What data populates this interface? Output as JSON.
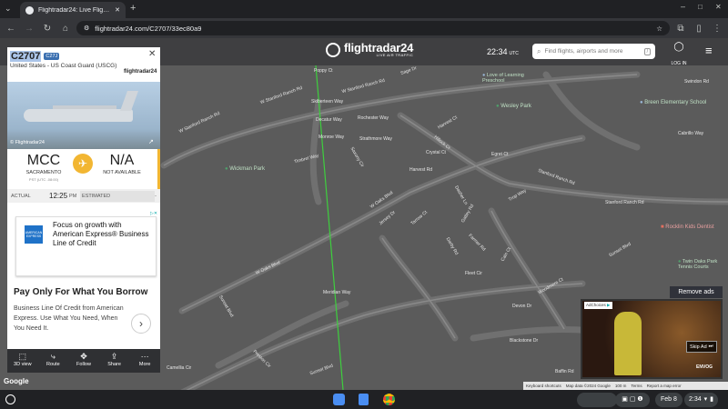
{
  "browser": {
    "tab_title": "Flightradar24: Live Flight Tracker",
    "url": "flightradar24.com/C2707/33ec80a9"
  },
  "header": {
    "logo": "flightradar24",
    "logo_sub": "LIVE AIR TRAFFIC",
    "time": "22:34",
    "time_zone": "UTC",
    "search_placeholder": "Find flights, airports and more",
    "search_key": "/",
    "login": "LOG IN"
  },
  "panel": {
    "callsign": "C2707",
    "type_badge": "C27J",
    "operator": "United States - US Coast Guard (USCG)",
    "operator_logo": "flightradar24",
    "photo_credit": "© Flightradar24",
    "origin": {
      "code": "MCC",
      "city": "SACRAMENTO",
      "tz": "PST (UTC -08:00)"
    },
    "destination": {
      "code": "N/A",
      "city": "NOT AVAILABLE"
    },
    "actual_label": "ACTUAL",
    "actual_time": "12:25",
    "actual_ampm": "PM",
    "estimated_label": "ESTIMATED",
    "estimated_value": "-",
    "ad": {
      "brand": "AMERICAN EXPRESS",
      "title": "Focus on growth with American Express® Business Line of Credit",
      "headline": "Pay Only For What You Borrow",
      "body": "Business Line Of Credit from American Express. Use What You Need, When You Need It.",
      "more": "Learn More"
    },
    "tabs": [
      {
        "label": "3D view",
        "icon": "cube-icon"
      },
      {
        "label": "Route",
        "icon": "route-icon"
      },
      {
        "label": "Follow",
        "icon": "follow-icon"
      },
      {
        "label": "Share",
        "icon": "share-icon"
      },
      {
        "label": "More",
        "icon": "more-icon"
      }
    ]
  },
  "map": {
    "streets": [
      "Poppy Ct",
      "Sage Dr",
      "W Stanford Ranch Rd",
      "W Stanford Ranch Rd",
      "Skiberteen Way",
      "Decatur Way",
      "Rochester Way",
      "Harvest Ct",
      "Monroe Way",
      "Strathmore Way",
      "Hillock Ct",
      "W Stanford Ranch Rd",
      "Timbrel Way",
      "Saxony Cir",
      "Crystal Ct",
      "Harvest Rd",
      "Egret Ct",
      "Stanford Ranch Rd",
      "Trop Way",
      "Stanford Ranch Rd",
      "W Oaks Blvd",
      "Jersey Dr",
      "Tarrow Ct",
      "Dasher Ln",
      "Gatley Rd",
      "Farmer Rd",
      "Darby Rd",
      "Cain Ct",
      "W Oaks Blvd",
      "Meridian Way",
      "Fleet Cir",
      "Woodmere Ct",
      "Devon Dr",
      "Sunset Blvd",
      "Preston Cir",
      "Blackstone Dr",
      "Camellia Cir",
      "Sunset Blvd",
      "Baffin Rd",
      "Swindon Rd",
      "Cabrillo Way",
      "Sunset Blvd"
    ],
    "pois": [
      {
        "name": "Love of Learning Preschool"
      },
      {
        "name": "Wesley Park"
      },
      {
        "name": "Breen Elementary School"
      },
      {
        "name": "Wickman Park"
      },
      {
        "name": "Rocklin Kids Dentist"
      },
      {
        "name": "Twin Oaks Park Tennis Courts"
      }
    ],
    "attribution": [
      "Keyboard shortcuts",
      "Map data ©2024 Google",
      "100 m",
      "Terms",
      "Report a map error"
    ],
    "google": "Google"
  },
  "video_ad": {
    "remove": "Remove ads",
    "choices": "AdChoices",
    "skip": "Skip Ad",
    "brand": "ENVOG"
  },
  "shelf": {
    "date": "Feb 8",
    "time": "2:34"
  }
}
